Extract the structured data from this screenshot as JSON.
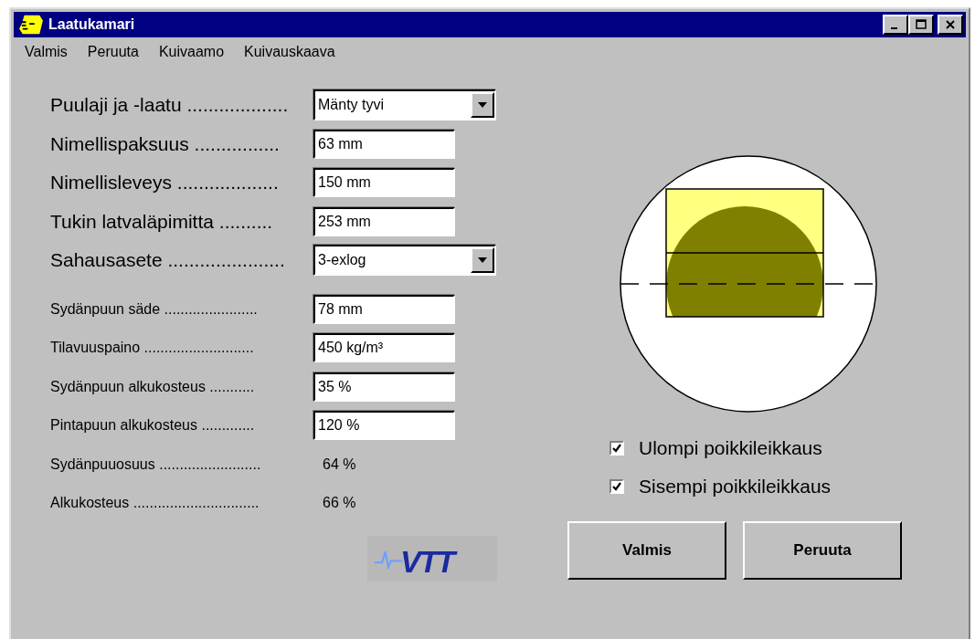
{
  "window": {
    "title": "Laatukamari"
  },
  "menu": [
    "Valmis",
    "Peruuta",
    "Kuivaamo",
    "Kuivauskaava"
  ],
  "main_fields": [
    {
      "kind": "dropdown",
      "label": "Puulaji ja -laatu ...................",
      "value": "Mänty tyvi"
    },
    {
      "kind": "input",
      "label": "Nimellispaksuus ................",
      "value": "63 mm"
    },
    {
      "kind": "input",
      "label": "Nimellisleveys ...................",
      "value": "150 mm"
    },
    {
      "kind": "input",
      "label": "Tukin latvaläpimitta ..........",
      "value": "253 mm"
    },
    {
      "kind": "dropdown",
      "label": "Sahausasete ......................",
      "value": "3-exlog"
    }
  ],
  "detail_fields": [
    {
      "kind": "input",
      "label": "Sydänpuun säde .......................",
      "value": "78 mm"
    },
    {
      "kind": "input",
      "label": "Tilavuuspaino ...........................",
      "value": "450 kg/m³"
    },
    {
      "kind": "input",
      "label": "Sydänpuun alkukosteus ...........",
      "value": "35 %"
    },
    {
      "kind": "input",
      "label": "Pintapuun alkukosteus .............",
      "value": "120 %"
    },
    {
      "kind": "readout",
      "label": "Sydänpuuosuus .........................",
      "value": "64 %"
    },
    {
      "kind": "readout",
      "label": "Alkukosteus ...............................",
      "value": "66 %"
    }
  ],
  "checkboxes": [
    {
      "label": "Ulompi poikkileikkaus",
      "checked": true
    },
    {
      "label": "Sisempi poikkileikkaus",
      "checked": true
    }
  ],
  "buttons": [
    "Valmis",
    "Peruuta"
  ],
  "logo": {
    "text": "VTT"
  }
}
